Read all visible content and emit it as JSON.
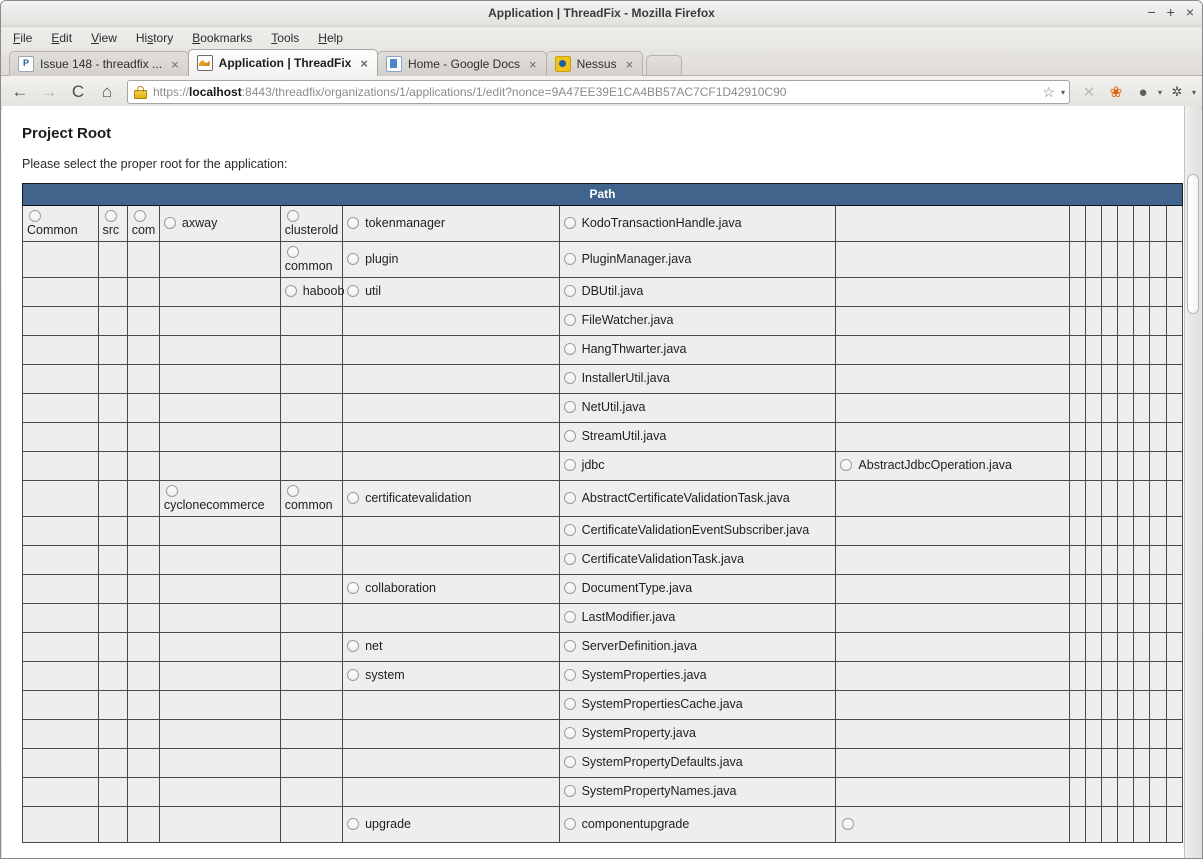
{
  "window": {
    "title": "Application | ThreadFix - Mozilla Firefox",
    "minimize": "−",
    "maximize": "+",
    "close": "×"
  },
  "menubar": [
    {
      "label": "File",
      "accel": "F"
    },
    {
      "label": "Edit",
      "accel": "E"
    },
    {
      "label": "View",
      "accel": "V"
    },
    {
      "label": "History",
      "accel": "s"
    },
    {
      "label": "Bookmarks",
      "accel": "B"
    },
    {
      "label": "Tools",
      "accel": "T"
    },
    {
      "label": "Help",
      "accel": "H"
    }
  ],
  "tabs": [
    {
      "label": "Issue 148 - threadfix ...",
      "icon": "bitbucket-favicon",
      "active": false,
      "close": "×"
    },
    {
      "label": "Application | ThreadFix",
      "icon": "threadfix-favicon",
      "active": true,
      "close": "×"
    },
    {
      "label": "Home - Google Docs",
      "icon": "googledocs-favicon",
      "active": false,
      "close": "×"
    },
    {
      "label": "Nessus",
      "icon": "nessus-favicon",
      "active": false,
      "close": "×"
    }
  ],
  "toolbar": {
    "back": "←",
    "forward": "→",
    "reload": "C",
    "home": "⌂",
    "stop": "✕",
    "firefox_menu": "🦊",
    "addon_one": "◍",
    "addon_two": "✖",
    "bookmark_star": "☆",
    "dropdown_caret": "▾"
  },
  "urlbar": {
    "scheme": "https://",
    "host": "localhost",
    "rest": ":8443/threadfix/organizations/1/applications/1/edit?nonce=9A47EE39E1CA4BB57AC7CF1D42910C90",
    "full": "https://localhost:8443/threadfix/organizations/1/applications/1/edit?nonce=9A47EE39E1CA4BB57AC7CF1D42910C90",
    "security_icon": "padlock-icon"
  },
  "page": {
    "heading": "Project Root",
    "instructions": "Please select the proper root for the application:"
  },
  "colors": {
    "table_header_bg": "#41648c",
    "table_header_text": "#ffffff",
    "cell_bg": "#eeeeee",
    "cell_border": "#4a4a4a"
  },
  "table": {
    "header": "Path",
    "narrow_column_count": 7,
    "rows": [
      [
        "Common",
        "src",
        "com",
        "axway",
        "clusterold",
        "tokenmanager",
        "KodoTransactionHandle.java",
        ""
      ],
      [
        "",
        "",
        "",
        "",
        "common",
        "plugin",
        "PluginManager.java",
        ""
      ],
      [
        "",
        "",
        "",
        "",
        "haboob",
        "util",
        "DBUtil.java",
        ""
      ],
      [
        "",
        "",
        "",
        "",
        "",
        "",
        "FileWatcher.java",
        ""
      ],
      [
        "",
        "",
        "",
        "",
        "",
        "",
        "HangThwarter.java",
        ""
      ],
      [
        "",
        "",
        "",
        "",
        "",
        "",
        "InstallerUtil.java",
        ""
      ],
      [
        "",
        "",
        "",
        "",
        "",
        "",
        "NetUtil.java",
        ""
      ],
      [
        "",
        "",
        "",
        "",
        "",
        "",
        "StreamUtil.java",
        ""
      ],
      [
        "",
        "",
        "",
        "",
        "",
        "",
        "jdbc",
        "AbstractJdbcOperation.java"
      ],
      [
        "",
        "",
        "",
        "cyclonecommerce",
        "common",
        "certificatevalidation",
        "AbstractCertificateValidationTask.java",
        ""
      ],
      [
        "",
        "",
        "",
        "",
        "",
        "",
        "CertificateValidationEventSubscriber.java",
        ""
      ],
      [
        "",
        "",
        "",
        "",
        "",
        "",
        "CertificateValidationTask.java",
        ""
      ],
      [
        "",
        "",
        "",
        "",
        "",
        "collaboration",
        "DocumentType.java",
        ""
      ],
      [
        "",
        "",
        "",
        "",
        "",
        "",
        "LastModifier.java",
        ""
      ],
      [
        "",
        "",
        "",
        "",
        "",
        "net",
        "ServerDefinition.java",
        ""
      ],
      [
        "",
        "",
        "",
        "",
        "",
        "system",
        "SystemProperties.java",
        ""
      ],
      [
        "",
        "",
        "",
        "",
        "",
        "",
        "SystemPropertiesCache.java",
        ""
      ],
      [
        "",
        "",
        "",
        "",
        "",
        "",
        "SystemProperty.java",
        ""
      ],
      [
        "",
        "",
        "",
        "",
        "",
        "",
        "SystemPropertyDefaults.java",
        ""
      ],
      [
        "",
        "",
        "",
        "",
        "",
        "",
        "SystemPropertyNames.java",
        ""
      ],
      [
        "",
        "",
        "",
        "",
        "",
        "upgrade",
        "componentupgrade",
        " "
      ]
    ],
    "wrapped_cells": [
      {
        "row": 0,
        "col": 0
      },
      {
        "row": 0,
        "col": 1
      },
      {
        "row": 0,
        "col": 2
      },
      {
        "row": 0,
        "col": 4
      },
      {
        "row": 1,
        "col": 4
      },
      {
        "row": 9,
        "col": 3
      },
      {
        "row": 9,
        "col": 4
      },
      {
        "row": 20,
        "col": 7
      }
    ],
    "tall_rows": [
      0,
      1,
      9,
      20
    ]
  }
}
